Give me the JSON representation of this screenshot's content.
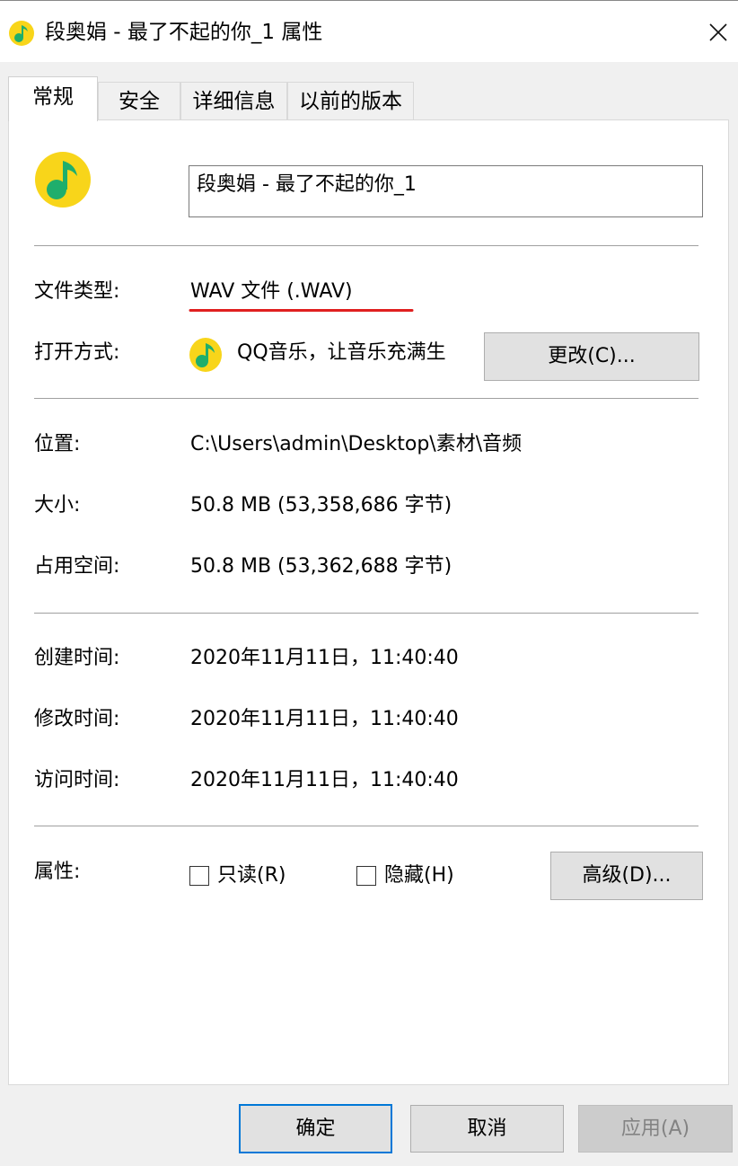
{
  "window": {
    "title": "段奥娟 - 最了不起的你_1 属性",
    "close_icon": "close-icon"
  },
  "tabs": [
    {
      "label": "常规"
    },
    {
      "label": "安全"
    },
    {
      "label": "详细信息"
    },
    {
      "label": "以前的版本"
    }
  ],
  "general": {
    "file_name": "段奥娟 - 最了不起的你_1",
    "file_type_label": "文件类型:",
    "file_type_value": "WAV 文件 (.WAV)",
    "open_with_label": "打开方式:",
    "open_with_value": "QQ音乐，让音乐充满生",
    "change_button": "更改(C)...",
    "location_label": "位置:",
    "location_value": "C:\\Users\\admin\\Desktop\\素材\\音频",
    "size_label": "大小:",
    "size_value": "50.8 MB (53,358,686 字节)",
    "disk_size_label": "占用空间:",
    "disk_size_value": "50.8 MB (53,362,688 字节)",
    "created_label": "创建时间:",
    "created_value": "2020年11月11日，11:40:40",
    "modified_label": "修改时间:",
    "modified_value": "2020年11月11日，11:40:40",
    "accessed_label": "访问时间:",
    "accessed_value": "2020年11月11日，11:40:40",
    "attributes_label": "属性:",
    "readonly_label": "只读(R)",
    "readonly_checked": false,
    "hidden_label": "隐藏(H)",
    "hidden_checked": false,
    "advanced_button": "高级(D)..."
  },
  "footer": {
    "ok_button": "确定",
    "cancel_button": "取消",
    "apply_button": "应用(A)"
  },
  "colors": {
    "app_icon_yellow": "#f8d51a",
    "app_icon_green": "#1fae6c",
    "primary_border": "#0078d7",
    "underline_red": "#e02020"
  }
}
